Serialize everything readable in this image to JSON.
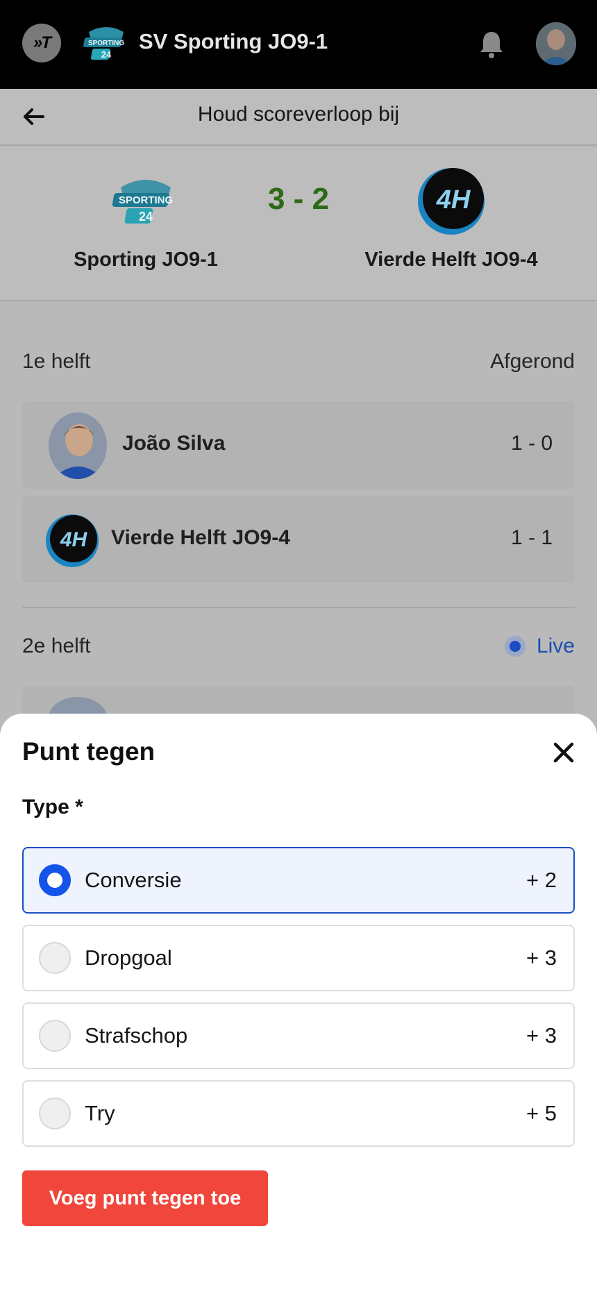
{
  "appbar": {
    "app_logo_text": "»T",
    "club_name": "SV Sporting JO9-1"
  },
  "subheader": {
    "title": "Houd scoreverloop bij"
  },
  "match": {
    "home_team": "Sporting JO9-1",
    "away_team": "Vierde Helft JO9-4",
    "score": "3 - 2",
    "away_logo_text": "4H"
  },
  "halves": [
    {
      "label": "1e helft",
      "status": "Afgerond",
      "events": [
        {
          "name": "João Silva",
          "score": "1 - 0"
        },
        {
          "name": "Vierde Helft JO9-4",
          "score": "1 - 1"
        }
      ]
    },
    {
      "label": "2e helft",
      "status": "Live"
    }
  ],
  "sheet": {
    "title": "Punt tegen",
    "type_label": "Type *",
    "options": [
      {
        "label": "Conversie",
        "points": "+ 2",
        "selected": true
      },
      {
        "label": "Dropgoal",
        "points": "+ 3",
        "selected": false
      },
      {
        "label": "Strafschop",
        "points": "+ 3",
        "selected": false
      },
      {
        "label": "Try",
        "points": "+ 5",
        "selected": false
      }
    ],
    "submit_label": "Voeg punt tegen toe"
  },
  "colors": {
    "score": "#2d6a17",
    "live": "#1d4fb0",
    "selected_radio": "#1554e8",
    "submit": "#f0463c"
  }
}
